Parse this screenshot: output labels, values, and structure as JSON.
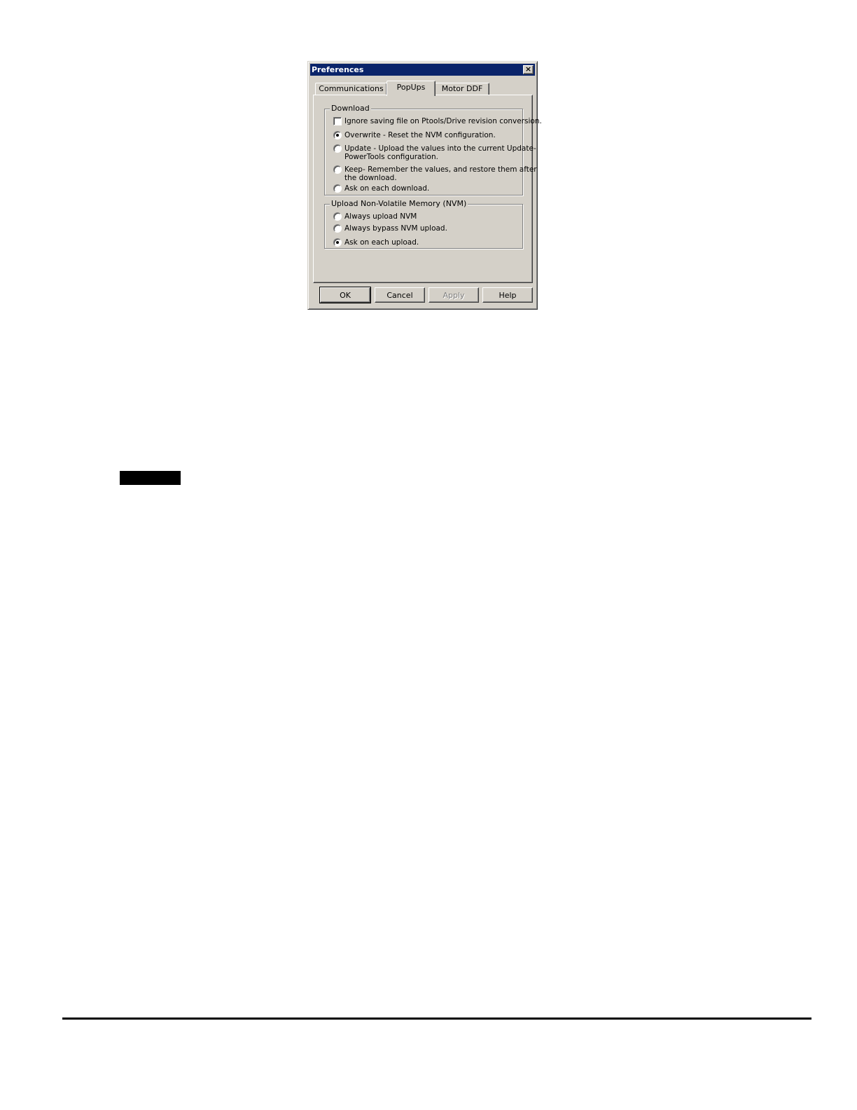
{
  "dialog": {
    "title": "Preferences",
    "close_symbol": "×",
    "close_icon": "close-icon"
  },
  "tabs": [
    {
      "label": "Communications",
      "active": false
    },
    {
      "label": "PopUps",
      "active": true
    },
    {
      "label": "Motor DDF",
      "active": false
    }
  ],
  "download": {
    "legend": "Download",
    "ignore_checkbox": {
      "label": "Ignore saving file on Ptools/Drive revision conversion.",
      "checked": false
    },
    "options": [
      {
        "label": "Overwrite - Reset the NVM configuration.",
        "selected": true
      },
      {
        "label_line1": "Update - Upload the values into the current Update-",
        "label_line2": "PowerTools configuration.",
        "selected": false
      },
      {
        "label_line1": "Keep- Remember the values, and restore them after",
        "label_line2": "the download.",
        "selected": false
      },
      {
        "label": "Ask on each download.",
        "selected": false
      }
    ]
  },
  "upload": {
    "legend": "Upload Non-Volatile Memory (NVM)",
    "options": [
      {
        "label": "Always upload NVM",
        "selected": false
      },
      {
        "label": "Always bypass NVM upload.",
        "selected": false
      },
      {
        "label": "Ask on each upload.",
        "selected": true
      }
    ]
  },
  "buttons": {
    "ok": "OK",
    "cancel": "Cancel",
    "apply": "Apply",
    "help": "Help",
    "apply_enabled": false
  },
  "colors": {
    "titlebar": "#0a246a",
    "dialog_face": "#d4d0c8"
  }
}
